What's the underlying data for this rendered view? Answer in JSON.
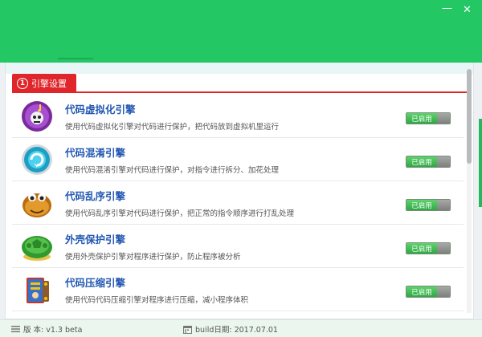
{
  "window": {
    "minimize_icon": "minimize-icon",
    "close_icon": "close-icon",
    "header_color": "#23c764"
  },
  "section": {
    "number": "1",
    "title": "引擎设置",
    "accent_color": "#e0262b"
  },
  "engines": [
    {
      "icon": "disc-skull-icon",
      "title": "代码虚拟化引擎",
      "description": "使用代码虚拟化引擎对代码进行保护，把代码放到虚拟机里运行",
      "status": "已启用"
    },
    {
      "icon": "cyan-swirl-icon",
      "title": "代码混淆引擎",
      "description": "使用代码混淆引擎对代码进行保护，对指令进行拆分、加花处理",
      "status": "已启用"
    },
    {
      "icon": "chestnut-face-icon",
      "title": "代码乱序引擎",
      "description": "使用代码乱序引擎对代码进行保护，把正常的指令顺序进行打乱处理",
      "status": "已启用"
    },
    {
      "icon": "turtle-shell-icon",
      "title": "外壳保护引擎",
      "description": "使用外壳保护引擎对程序进行保护，防止程序被分析",
      "status": "已启用"
    },
    {
      "icon": "compress-book-icon",
      "title": "代码压缩引擎",
      "description": "使用代码代码压缩引擎对程序进行压缩，减小程序体积",
      "status": "已启用"
    }
  ],
  "footer": {
    "version": "版 本: v1.3 beta",
    "build_date": "build日期: 2017.07.01"
  }
}
